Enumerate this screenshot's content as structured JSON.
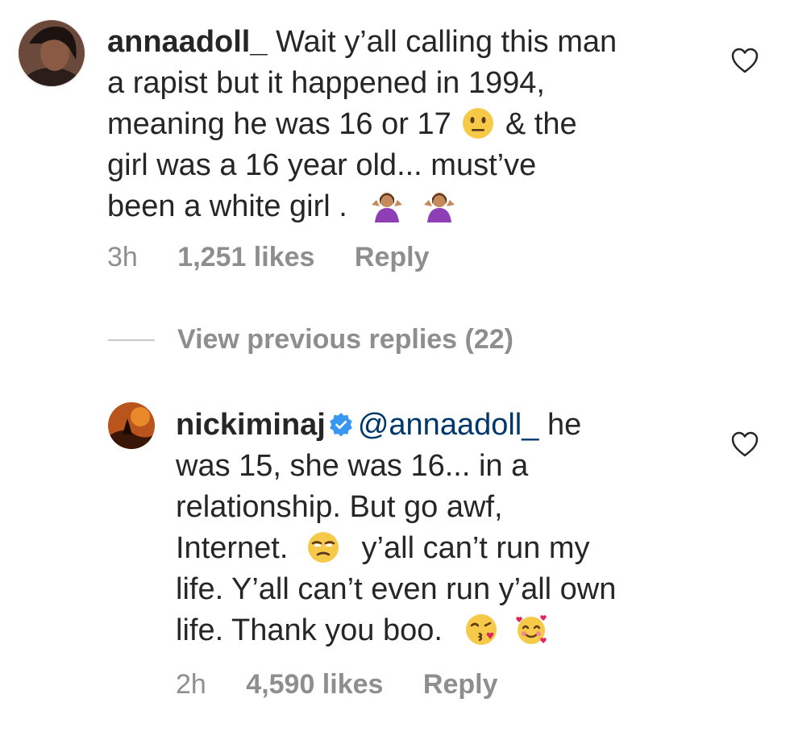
{
  "comments": [
    {
      "username": "annaadoll_",
      "lines": [
        "Wait y’all calling this man",
        "a rapist but it happened in 1994,",
        "meaning he was 16 or 17",
        "& the",
        "girl was a 16 year old... must’ve",
        "been a white girl ."
      ],
      "time": "3h",
      "likes": "1,251 likes",
      "reply_label": "Reply",
      "emoji": [
        "neutral-face-emoji",
        "shrug-emoji",
        "shrug-emoji"
      ]
    },
    {
      "username": "nickiminaj",
      "verified": true,
      "mention": "@annaadoll_",
      "lines": [
        "he",
        "was 15, she was 16... in a",
        "relationship. But go awf,",
        "Internet.",
        "y’all can’t run my",
        "life. Y’all can’t even run y’all own",
        "life. Thank you boo."
      ],
      "time": "2h",
      "likes": "4,590 likes",
      "reply_label": "Reply",
      "emoji": [
        "unamused-face-emoji",
        "kissing-heart-emoji",
        "smiling-hearts-emoji"
      ]
    }
  ],
  "view_replies_label": "View previous replies (22)",
  "colors": {
    "text": "#262626",
    "secondary": "#8e8e8e",
    "mention": "#00376b",
    "verified": "#3897f0"
  }
}
